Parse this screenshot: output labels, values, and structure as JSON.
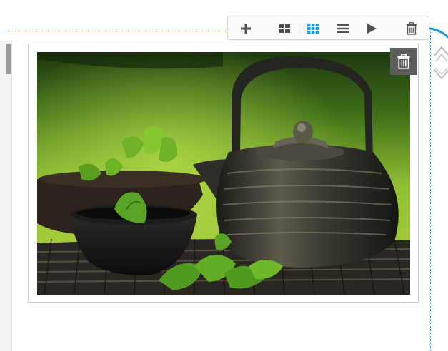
{
  "toolbar": {
    "buttons": [
      {
        "name": "add",
        "icon": "plus-icon"
      },
      {
        "name": "layout-two-column",
        "icon": "grid-2x2-icon"
      },
      {
        "name": "layout-three-column",
        "icon": "grid-3x3-icon",
        "active": true
      },
      {
        "name": "layout-list",
        "icon": "list-icon"
      },
      {
        "name": "play",
        "icon": "play-icon"
      },
      {
        "name": "delete",
        "icon": "trash-icon"
      }
    ]
  },
  "block": {
    "image": {
      "subject": "teapot-with-mint-photo"
    },
    "delete_icon": "trash-icon",
    "move_up_icon": "chevron-up-icon",
    "move_down_icon": "chevron-down-icon"
  },
  "colors": {
    "accent": "#1a9ad6",
    "guide": "#35a7d9",
    "toolbar_icon": "#555555",
    "delete_overlay": "#5c5c5c"
  }
}
